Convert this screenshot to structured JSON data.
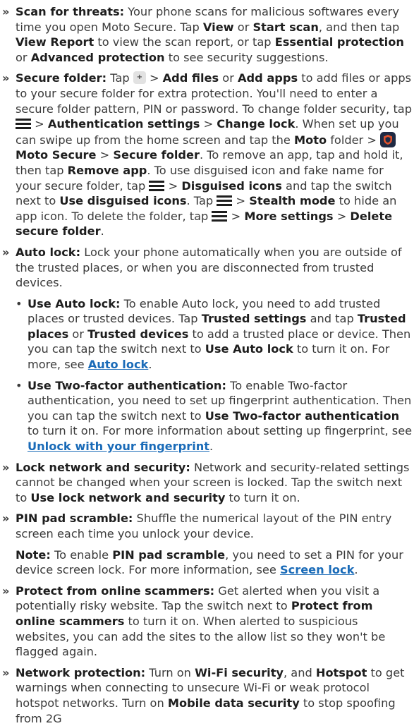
{
  "marker": "»",
  "dot": "•",
  "gt": ">",
  "scan": {
    "title": "Scan for threats:",
    "t1": " Your phone scans for malicious softwares every time you open Moto Secure. Tap ",
    "view": "View",
    "t2": " or ",
    "start": "Start scan",
    "t3": ", and then tap ",
    "view_report": "View Report",
    "t4": " to view the scan report, or tap ",
    "essential": "Essential protection",
    "t5": " or ",
    "advanced": "Advanced protection",
    "t6": " to see security suggestions."
  },
  "folder": {
    "title": "Secure folder:",
    "t1": " Tap ",
    "t2": " > ",
    "add_files": "Add files",
    "t3": " or ",
    "add_apps": "Add apps",
    "t4": " to add files or apps to your secure folder for extra protection. You'll need to enter a secure folder pattern, PIN or password. To change folder security, tap ",
    "t5": " > ",
    "auth_settings": "Authentication settings",
    "t6": " > ",
    "change_lock": "Change lock",
    "t7": ". When set up you can swipe up from the home screen and tap the ",
    "moto": "Moto",
    "t8": " folder > ",
    "moto_secure": "Moto Secure",
    "t9": " > ",
    "secure_folder": "Secure folder",
    "t10": ". To remove an app, tap and hold it, then tap ",
    "remove_app": "Remove app",
    "t11": ". To use disguised icon and fake name for your secure folder, tap ",
    "t12": " > ",
    "disguised_icons": "Disguised icons",
    "t13": " and tap the switch next to ",
    "use_disguised": "Use disguised icons",
    "t14": ". Tap ",
    "t15": " > ",
    "stealth": "Stealth mode",
    "t16": " to hide an app icon. To delete the folder, tap ",
    "t17": " > ",
    "more_settings": "More settings",
    "t18": " > ",
    "delete_folder": "Delete secure folder",
    "t19": "."
  },
  "autolock": {
    "title": "Auto lock:",
    "t1": " Lock your phone automatically when you are outside of the trusted places, or when you are disconnected from trusted devices."
  },
  "use_autolock": {
    "title": "Use Auto lock:",
    "t1": " To enable Auto lock, you need to add trusted places or trusted devices. Tap ",
    "trusted_settings": "Trusted settings",
    "t2": " and tap ",
    "trusted_places": "Trusted places",
    "t3": " or ",
    "trusted_devices": "Trusted devices",
    "t4": " to add a trusted place or device. Then you can tap the switch next to ",
    "use_autolock2": "Use Auto lock",
    "t5": " to turn it on. For more, see ",
    "link": "Auto lock",
    "t6": "."
  },
  "twofa": {
    "title": "Use Two-factor authentication:",
    "t1": " To enable Two-factor authentication, you need to set up fingerprint authentication. Then you can tap the switch next to ",
    "use_twofa": "Use Two-factor authentication",
    "t2": " to turn it on. For more information about setting up fingerprint, see ",
    "link": "Unlock with your fingerprint",
    "t3": "."
  },
  "locknet": {
    "title": "Lock network and security:",
    "t1": " Network and security-related settings cannot be changed when your screen is locked. Tap the switch next to ",
    "use_lock": "Use lock network and security",
    "t2": " to turn it on."
  },
  "pinpad": {
    "title": "PIN pad scramble:",
    "t1": " Shuffle the numerical layout of the PIN entry screen each time you unlock your device."
  },
  "note": {
    "label": "Note:",
    "t1": " To enable ",
    "pin_pad": "PIN pad scramble",
    "t2": ", you need to set a PIN for your device screen lock. For more information, see ",
    "link": "Screen lock",
    "t3": "."
  },
  "scammers": {
    "title": "Protect from online scammers:",
    "t1": " Get alerted when you visit a potentially risky website. Tap the switch next to ",
    "protect": "Protect from online scammers",
    "t2": " to turn it on. When alerted to suspicious websites, you can add the sites to the allow list so they won't be flagged again."
  },
  "netprot": {
    "title": "Network protection:",
    "t1": " Turn on ",
    "wifi": "Wi-Fi security",
    "t2": ", and ",
    "hotspot": "Hotspot",
    "t3": " to get warnings when connecting to unsecure Wi-Fi or weak protocol hotspot networks. Turn on ",
    "mobile": "Mobile data security",
    "t4": " to stop spoofing from 2G"
  },
  "colors": {
    "link": "#1a6bb8",
    "text": "#3a3a3a",
    "shield_bg": "#1f2a44",
    "shield_accent": "#e0522d"
  },
  "icons": {
    "add": "plus-button-icon",
    "menu": "hamburger-menu-icon",
    "app": "moto-secure-shield-icon"
  }
}
